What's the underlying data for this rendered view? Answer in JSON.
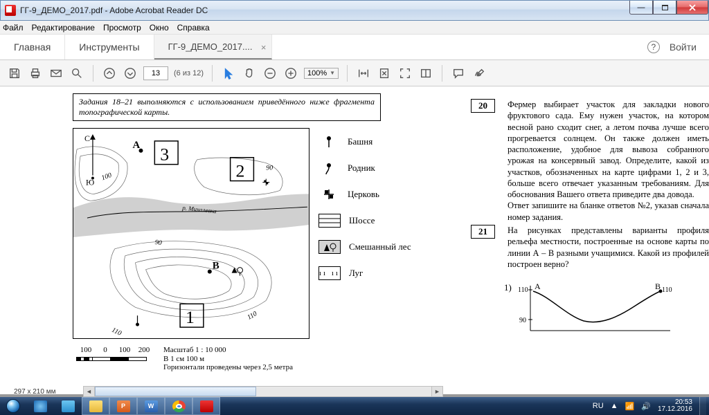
{
  "window": {
    "title": "ГГ-9_ДЕМО_2017.pdf - Adobe Acrobat Reader DC"
  },
  "menu": {
    "file": "Файл",
    "edit": "Редактирование",
    "view": "Просмотр",
    "window": "Окно",
    "help": "Справка"
  },
  "tabs": {
    "home": "Главная",
    "tools": "Инструменты",
    "doc": "ГГ-9_ДЕМО_2017....",
    "signin": "Войти"
  },
  "toolbar": {
    "page_current": "13",
    "page_total": "(6 из 12)",
    "zoom": "100%"
  },
  "doc": {
    "instruction": "Задания 18–21 выполняются с использованием приведённого ниже фрагмента топографической карты.",
    "legend": {
      "tower": "Башня",
      "spring": "Родник",
      "church": "Церковь",
      "road": "Шоссе",
      "forest": "Смешанный лес",
      "meadow": "Луг"
    },
    "scale": {
      "nums": [
        "100",
        "0",
        "100",
        "200"
      ],
      "label1": "Масштаб   1 : 10 000",
      "label2": "В 1 см 100 м",
      "label3": "Горизонтали проведены через 2,5 метра"
    },
    "map_labels": {
      "a": "А",
      "b": "В",
      "c": "С",
      "yu": "Ю",
      "n1": "1",
      "n2": "2",
      "n3": "3",
      "river": "р. Михалевка",
      "h90": "90",
      "h100": "100",
      "h110a": "110",
      "h110b": "110",
      "h90b": "90"
    },
    "q20_num": "20",
    "q20_text": "Фермер выбирает участок для закладки нового фруктового сада. Ему нужен участок, на котором весной рано сходит снег, а летом почва лучше всего прогревается солнцем. Он также должен иметь расположение, удобное для вывоза собранного урожая на консервный завод. Определите, какой из участков, обозначенных на карте цифрами 1, 2 и 3, больше всего отвечает указанным требованиям. Для обоснования Вашего ответа приведите два довода.",
    "q20_text2": "Ответ запишите на бланке ответов №2, указав сначала номер задания.",
    "q21_num": "21",
    "q21_text": "На рисунках представлены варианты профиля рельефа местности, построенные на основе карты по линии А – В разными учащимися. Какой из профилей построен верно?",
    "q21_opt1": "1)",
    "prof_a": "А",
    "prof_b": "В",
    "prof_110a": "110",
    "prof_110b": "110",
    "prof_90": "90"
  },
  "status": {
    "page_size": "297 x 210 мм"
  },
  "tray": {
    "lang": "RU",
    "time": "20:53",
    "date": "17.12.2016"
  }
}
